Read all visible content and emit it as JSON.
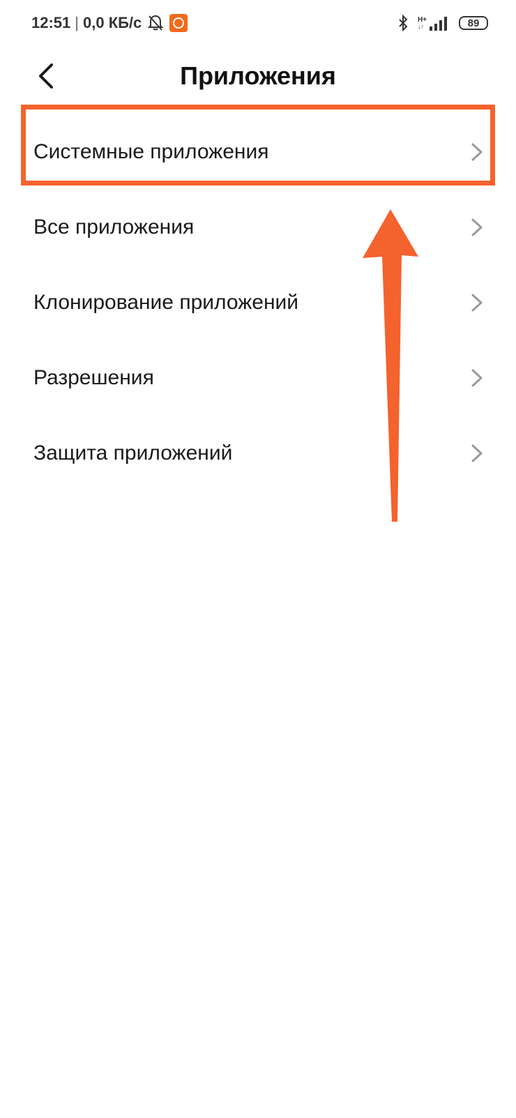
{
  "status_bar": {
    "time": "12:51",
    "separator": "|",
    "network_speed": "0,0 КБ/с",
    "network_type": "H+",
    "battery": "89",
    "icons": [
      "bell-muted-icon",
      "mi-icon",
      "bluetooth-icon",
      "signal-icon",
      "battery-icon"
    ]
  },
  "header": {
    "title": "Приложения",
    "back_icon": "chevron-left-icon"
  },
  "menu": {
    "items": [
      {
        "label": "Системные приложения"
      },
      {
        "label": "Все приложения"
      },
      {
        "label": "Клонирование приложений"
      },
      {
        "label": "Разрешения"
      },
      {
        "label": "Защита приложений"
      }
    ],
    "chevron_icon": "chevron-right-icon"
  },
  "colors": {
    "annotation": "#f4622d",
    "text": "#1a1a1a",
    "chevron": "#9a9a9a",
    "background": "#ffffff"
  }
}
